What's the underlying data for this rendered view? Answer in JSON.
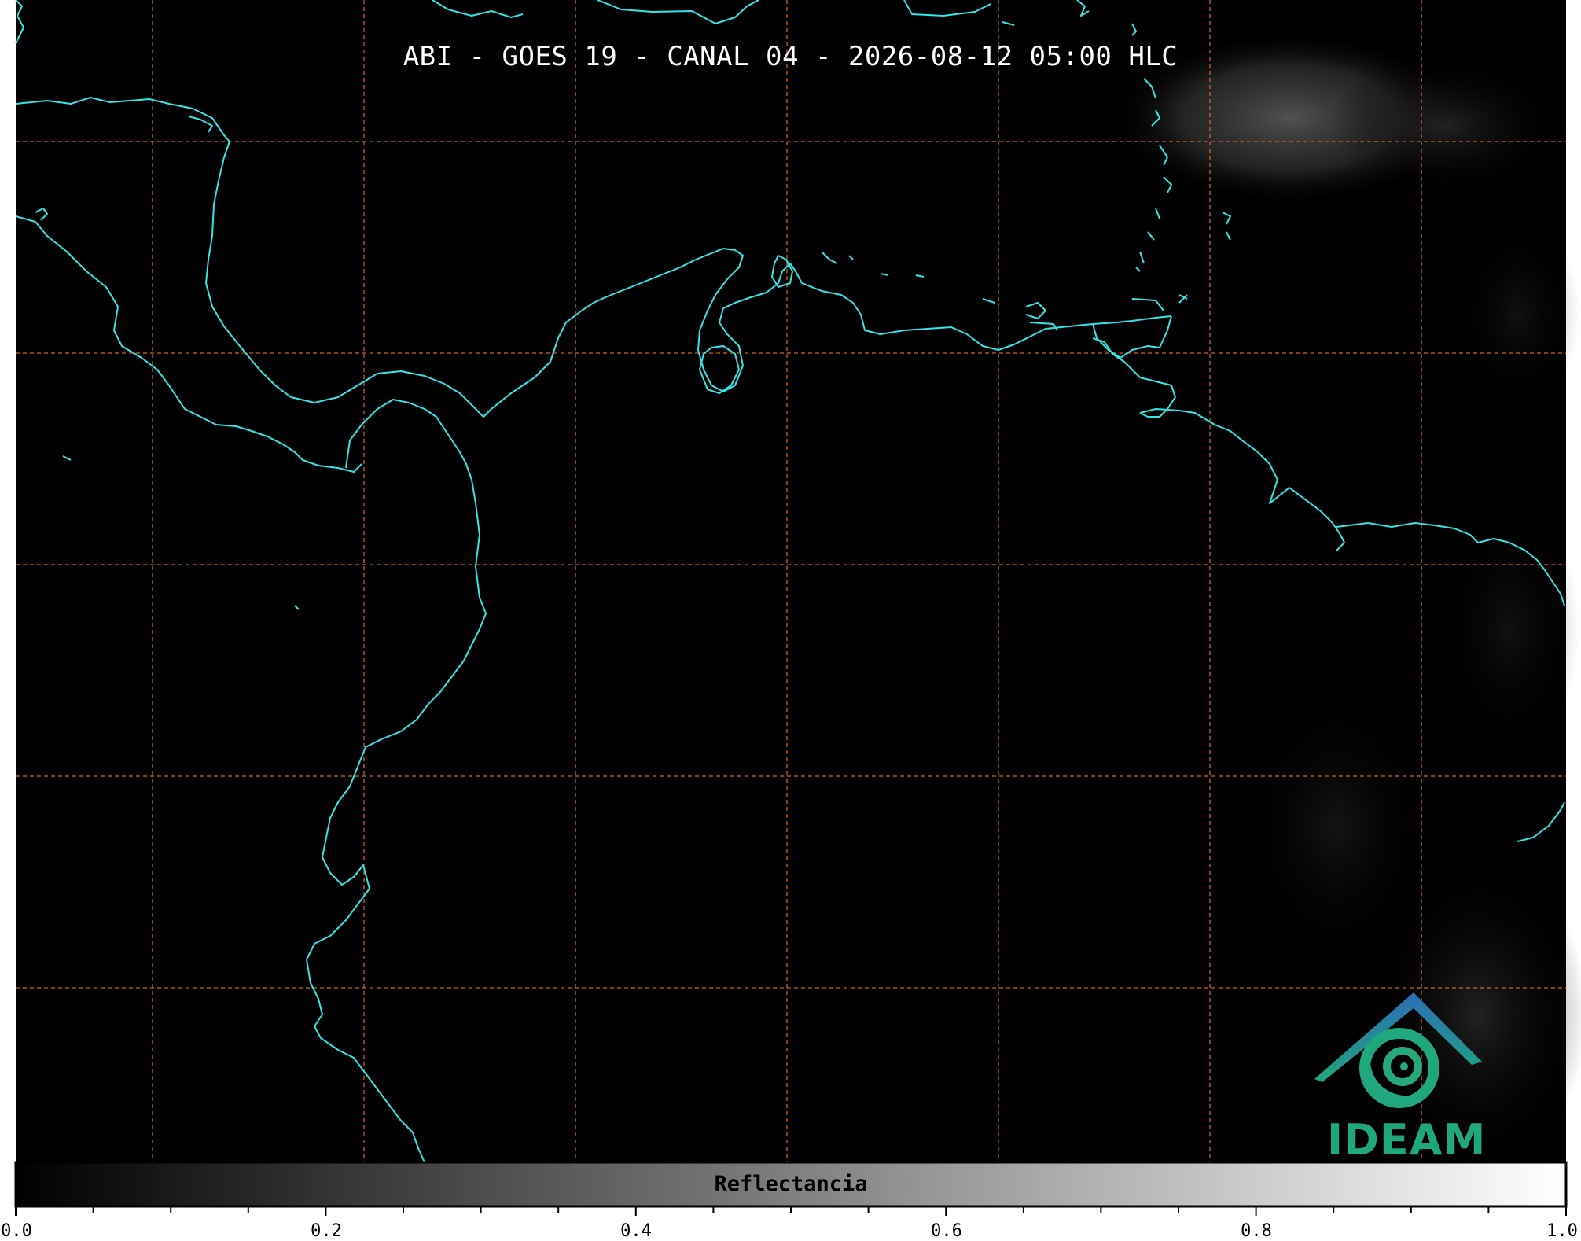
{
  "title": "ABI - GOES 19 - CANAL 04 - 2026-08-12 05:00 HLC",
  "colorbar": {
    "label": "Reflectancia",
    "ticks": [
      "0.0",
      "0.2",
      "0.4",
      "0.6",
      "0.8",
      "1.0"
    ],
    "range": [
      0.0,
      1.0
    ],
    "colormap": "grayscale"
  },
  "logo": {
    "text": "IDEAM"
  },
  "colors": {
    "background": "#000000",
    "coastline": "#33e6e6",
    "gridlines": "#c8662a",
    "logo_text": "#1fa77d"
  },
  "map": {
    "gridlines": "dashed orange lat/lon graticule",
    "coastline_style": "cyan outlines"
  }
}
